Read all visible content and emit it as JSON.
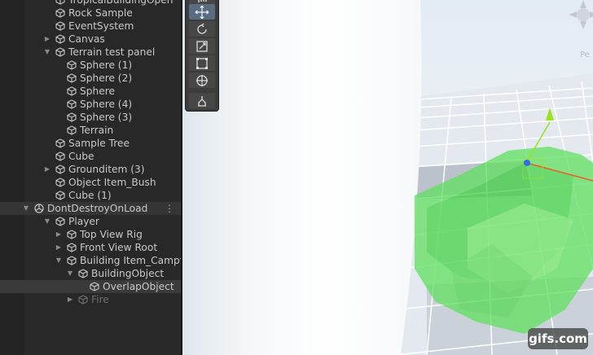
{
  "hierarchy": {
    "items": [
      {
        "label": "TropicalBuildingOpen",
        "expanded": null,
        "type": "gameobject"
      },
      {
        "label": "Rock Sample",
        "expanded": null,
        "type": "gameobject"
      },
      {
        "label": "EventSystem",
        "expanded": null,
        "type": "gameobject"
      },
      {
        "label": "Canvas",
        "expanded": false,
        "type": "gameobject"
      },
      {
        "label": "Terrain test panel",
        "expanded": true,
        "type": "gameobject"
      },
      {
        "label": "Sphere (1)",
        "expanded": null,
        "type": "gameobject"
      },
      {
        "label": "Sphere (2)",
        "expanded": null,
        "type": "gameobject"
      },
      {
        "label": "Sphere",
        "expanded": null,
        "type": "gameobject"
      },
      {
        "label": "Sphere (4)",
        "expanded": null,
        "type": "gameobject"
      },
      {
        "label": "Sphere (3)",
        "expanded": null,
        "type": "gameobject"
      },
      {
        "label": "Terrain",
        "expanded": null,
        "type": "gameobject"
      },
      {
        "label": "Sample Tree",
        "expanded": null,
        "type": "gameobject"
      },
      {
        "label": "Cube",
        "expanded": null,
        "type": "gameobject"
      },
      {
        "label": "Grounditem (3)",
        "expanded": false,
        "type": "gameobject"
      },
      {
        "label": "Object Item_Bush",
        "expanded": null,
        "type": "gameobject"
      },
      {
        "label": "Cube (1)",
        "expanded": null,
        "type": "gameobject"
      },
      {
        "label": "DontDestroyOnLoad",
        "expanded": true,
        "type": "scene",
        "menu": "⋮"
      },
      {
        "label": "Player",
        "expanded": true,
        "type": "gameobject"
      },
      {
        "label": "Top View Rig",
        "expanded": false,
        "type": "gameobject"
      },
      {
        "label": "Front View Root",
        "expanded": false,
        "type": "gameobject"
      },
      {
        "label": "Building Item_Campfire(Cl",
        "expanded": true,
        "type": "gameobject"
      },
      {
        "label": "BuildingObject",
        "expanded": true,
        "type": "gameobject"
      },
      {
        "label": "OverlapObject",
        "expanded": null,
        "type": "gameobject",
        "selected": true
      },
      {
        "label": "Fire",
        "expanded": false,
        "type": "gameobject",
        "inactive": true
      }
    ]
  },
  "scene": {
    "persp_label": "Pe",
    "tools": [
      {
        "name": "hand-tool",
        "icon": "hand-icon"
      },
      {
        "name": "move-tool",
        "icon": "move-icon",
        "active": true
      },
      {
        "name": "rotate-tool",
        "icon": "rotate-icon"
      },
      {
        "name": "scale-tool",
        "icon": "scale-icon"
      },
      {
        "name": "rect-tool",
        "icon": "rect-icon"
      },
      {
        "name": "transform-tool",
        "icon": "transform-icon"
      },
      {
        "name": "custom-tool",
        "icon": "custom-tool-icon"
      }
    ],
    "colors": {
      "overlap_green": "#5fe05f",
      "grid_line": "#ffffff",
      "tile": "#dde5ec",
      "gizmo_y": "#9be21e",
      "gizmo_z": "#2f6fe0",
      "gizmo_x": "#f05a28"
    }
  },
  "watermark": "gifs.com"
}
